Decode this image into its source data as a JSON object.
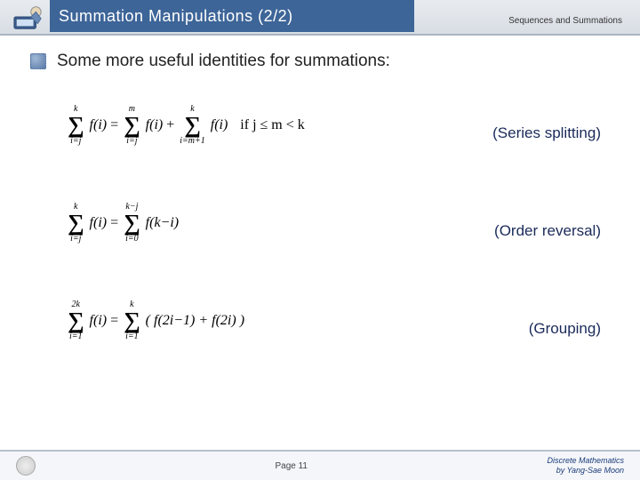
{
  "header": {
    "title": "Summation Manipulations (2/2)",
    "subtitle": "Sequences and Summations"
  },
  "main": {
    "bullet": "Some more useful identities for summations:",
    "identities": [
      {
        "eq_lhs_up": "k",
        "eq_lhs_lo": "i=j",
        "eq_mid_up": "m",
        "eq_mid_lo": "i=j",
        "eq_rhs_up": "k",
        "eq_rhs_lo": "i=m+1",
        "cond": "if j ≤ m < k",
        "label": "(Series splitting)"
      },
      {
        "eq_lhs_up": "k",
        "eq_lhs_lo": "i=j",
        "eq_rhs_up": "k−j",
        "eq_rhs_lo": "i=0",
        "rhs_fn": "f(k−i)",
        "label": "(Order reversal)"
      },
      {
        "eq_lhs_up": "2k",
        "eq_lhs_lo": "i=1",
        "eq_rhs_up": "k",
        "eq_rhs_lo": "i=1",
        "rhs_fn": "( f(2i−1) + f(2i) )",
        "label": "(Grouping)"
      }
    ]
  },
  "footer": {
    "page": "Page 11",
    "course": "Discrete Mathematics",
    "author": "by Yang-Sae Moon"
  }
}
